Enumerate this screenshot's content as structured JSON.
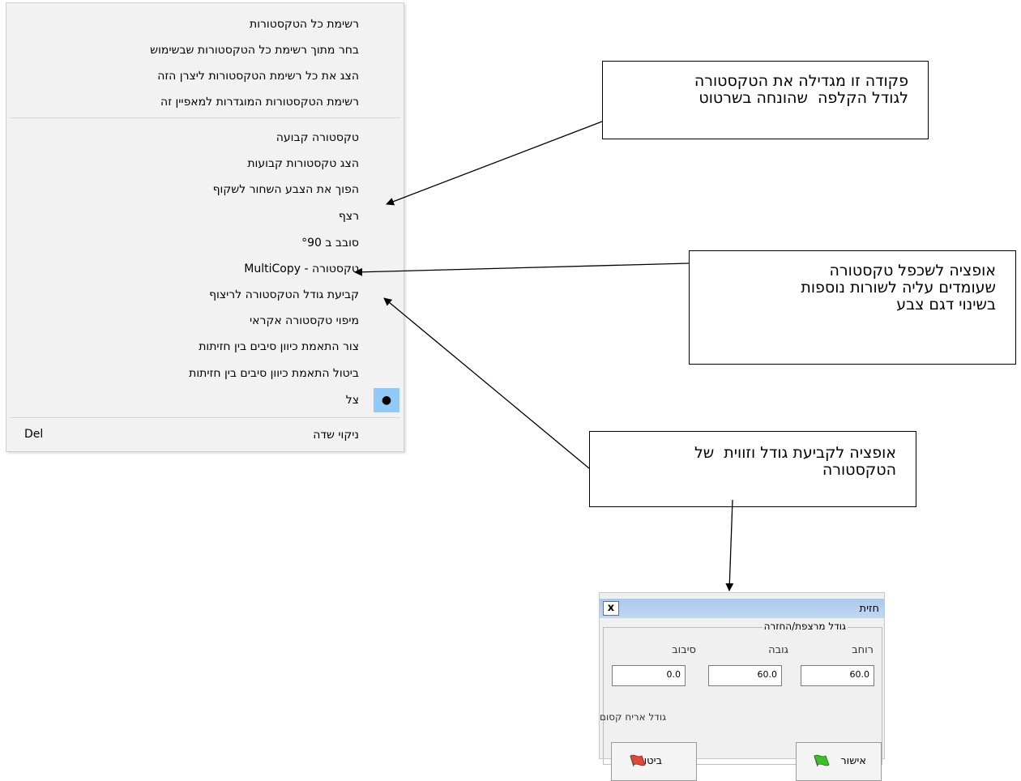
{
  "menu": {
    "items": [
      {
        "label": "רשימת כל הטקסטורות"
      },
      {
        "label": "בחר מתוך רשימת כל הטקסטורות שבשימוש"
      },
      {
        "label": "הצג את כל רשימת הטקסטורות ליצרן הזה"
      },
      {
        "label": "רשימת הטקסטורות המוגדרות למאפיין זה"
      },
      {
        "label": "טקסטורה קבועה"
      },
      {
        "label": "הצג טקסטורות קבועות"
      },
      {
        "label": "הפוך את הצבע השחור לשקוף"
      },
      {
        "label": "רצף"
      },
      {
        "label": "סובב ב °90"
      },
      {
        "label": "טקסטורה - MultiCopy"
      },
      {
        "label": "קביעת גודל הטקסטורה לריצוף"
      },
      {
        "label": "מיפוי טקסטורה אקראי"
      },
      {
        "label": "צור התאמת כיוון סיבים בין חזיתות"
      },
      {
        "label": "ביטול התאמת כיוון סיבים בין חזיתות"
      },
      {
        "label": "צל",
        "checked": true,
        "check_symbol": "●"
      },
      {
        "label": "ניקוי שדה",
        "accelerator": "Del"
      }
    ]
  },
  "callouts": {
    "one": {
      "line1": "פקודה זו מגדילה את הטקסטורה",
      "line2": "לגודל הקלפה  שהונחה בשרטוט"
    },
    "two": {
      "line1": "אופציה לשכפל טקסטורה",
      "line2": "שעומדים עליה לשורות נוספות",
      "line3": "בשינוי דגם צבע"
    },
    "three": {
      "line1": "אופציה לקביעת גודל וזווית  של",
      "line2": "הטקסטורה"
    }
  },
  "dialog": {
    "title": "חזית",
    "close_label": "x",
    "group_title": "גודל מרצפת/החזרה",
    "labels": {
      "width": "רוחב",
      "height": "גובה",
      "rotation": "סיבוב"
    },
    "values": {
      "width": "60.0",
      "height": "60.0",
      "rotation": "0.0"
    },
    "bottom_label": "גודל אריח קסום",
    "ok_label": "אישור",
    "cancel_label": "ביטול"
  },
  "colors": {
    "menu_bg": "#f2f2f2",
    "check_bg": "#91c9f7",
    "dialog_title": "#b4cfee",
    "flag_ok": "#3fbf2a",
    "flag_cancel": "#e04a3a"
  }
}
